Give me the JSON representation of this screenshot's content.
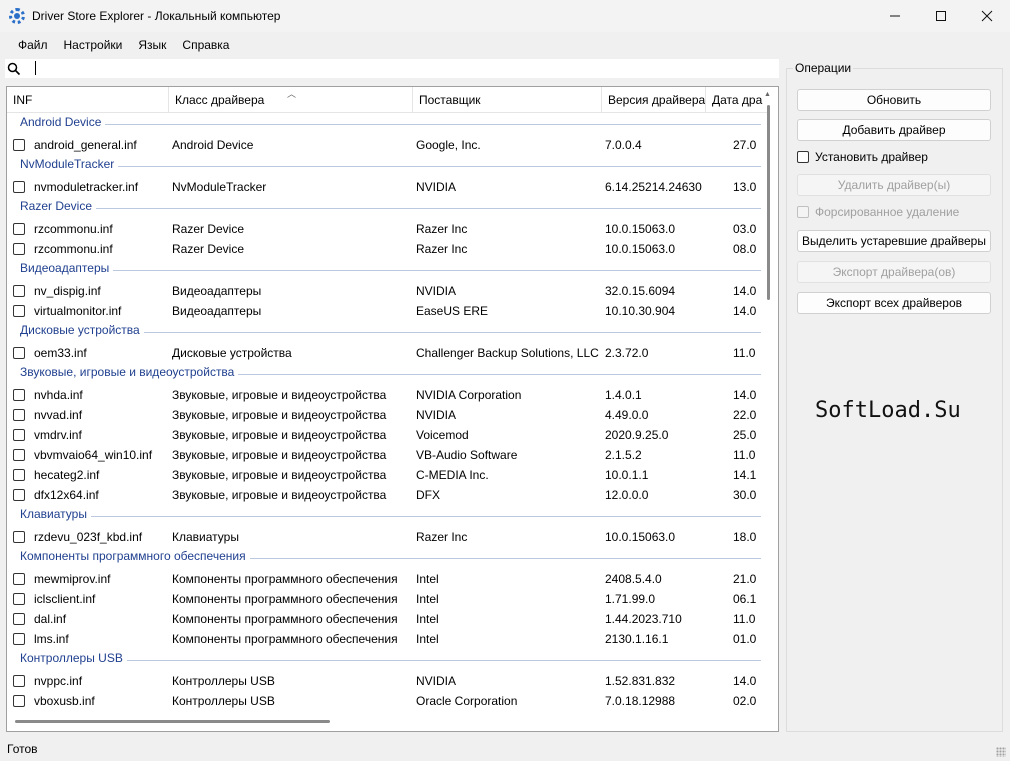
{
  "window": {
    "title": "Driver Store Explorer - Локальный компьютер",
    "icon": "gear-icon"
  },
  "menu": [
    "Файл",
    "Настройки",
    "Язык",
    "Справка"
  ],
  "search": {
    "value": "",
    "placeholder": ""
  },
  "columns": [
    "INF",
    "Класс драйвера",
    "Поставщик",
    "Версия драйвера",
    "Дата дра"
  ],
  "groups": [
    {
      "name": "Android Device",
      "rows": [
        {
          "inf": "android_general.inf",
          "cls": "Android Device",
          "prov": "Google, Inc.",
          "ver": "7.0.0.4",
          "date": "27.0"
        }
      ]
    },
    {
      "name": "NvModuleTracker",
      "rows": [
        {
          "inf": "nvmoduletracker.inf",
          "cls": "NvModuleTracker",
          "prov": "NVIDIA",
          "ver": "6.14.25214.24630",
          "date": "13.0"
        }
      ]
    },
    {
      "name": "Razer Device",
      "rows": [
        {
          "inf": "rzcommonu.inf",
          "cls": "Razer Device",
          "prov": "Razer Inc",
          "ver": "10.0.15063.0",
          "date": "03.0"
        },
        {
          "inf": "rzcommonu.inf",
          "cls": "Razer Device",
          "prov": "Razer Inc",
          "ver": "10.0.15063.0",
          "date": "08.0"
        }
      ]
    },
    {
      "name": "Видеоадаптеры",
      "rows": [
        {
          "inf": "nv_dispig.inf",
          "cls": "Видеоадаптеры",
          "prov": "NVIDIA",
          "ver": "32.0.15.6094",
          "date": "14.0"
        },
        {
          "inf": "virtualmonitor.inf",
          "cls": "Видеоадаптеры",
          "prov": "EaseUS ERE",
          "ver": "10.10.30.904",
          "date": "14.0"
        }
      ]
    },
    {
      "name": "Дисковые устройства",
      "rows": [
        {
          "inf": "oem33.inf",
          "cls": "Дисковые устройства",
          "prov": "Challenger Backup Solutions, LLC",
          "ver": "2.3.72.0",
          "date": "11.0"
        }
      ]
    },
    {
      "name": "Звуковые, игровые и видеоустройства",
      "rows": [
        {
          "inf": "nvhda.inf",
          "cls": "Звуковые, игровые и видеоустройства",
          "prov": "NVIDIA Corporation",
          "ver": "1.4.0.1",
          "date": "14.0"
        },
        {
          "inf": "nvvad.inf",
          "cls": "Звуковые, игровые и видеоустройства",
          "prov": "NVIDIA",
          "ver": "4.49.0.0",
          "date": "22.0"
        },
        {
          "inf": "vmdrv.inf",
          "cls": "Звуковые, игровые и видеоустройства",
          "prov": "Voicemod",
          "ver": "2020.9.25.0",
          "date": "25.0"
        },
        {
          "inf": "vbvmvaio64_win10.inf",
          "cls": "Звуковые, игровые и видеоустройства",
          "prov": "VB-Audio Software",
          "ver": "2.1.5.2",
          "date": "11.0"
        },
        {
          "inf": "hecateg2.inf",
          "cls": "Звуковые, игровые и видеоустройства",
          "prov": "C-MEDIA Inc.",
          "ver": "10.0.1.1",
          "date": "14.1"
        },
        {
          "inf": "dfx12x64.inf",
          "cls": "Звуковые, игровые и видеоустройства",
          "prov": "DFX",
          "ver": "12.0.0.0",
          "date": "30.0"
        }
      ]
    },
    {
      "name": "Клавиатуры",
      "rows": [
        {
          "inf": "rzdevu_023f_kbd.inf",
          "cls": "Клавиатуры",
          "prov": "Razer Inc",
          "ver": "10.0.15063.0",
          "date": "18.0"
        }
      ]
    },
    {
      "name": "Компоненты программного обеспечения",
      "rows": [
        {
          "inf": "mewmiprov.inf",
          "cls": "Компоненты программного обеспечения",
          "prov": "Intel",
          "ver": "2408.5.4.0",
          "date": "21.0"
        },
        {
          "inf": "iclsclient.inf",
          "cls": "Компоненты программного обеспечения",
          "prov": "Intel",
          "ver": "1.71.99.0",
          "date": "06.1"
        },
        {
          "inf": "dal.inf",
          "cls": "Компоненты программного обеспечения",
          "prov": "Intel",
          "ver": "1.44.2023.710",
          "date": "11.0"
        },
        {
          "inf": "lms.inf",
          "cls": "Компоненты программного обеспечения",
          "prov": "Intel",
          "ver": "2130.1.16.1",
          "date": "01.0"
        }
      ]
    },
    {
      "name": "Контроллеры USB",
      "rows": [
        {
          "inf": "nvppc.inf",
          "cls": "Контроллеры USB",
          "prov": "NVIDIA",
          "ver": "1.52.831.832",
          "date": "14.0"
        },
        {
          "inf": "vboxusb.inf",
          "cls": "Контроллеры USB",
          "prov": "Oracle Corporation",
          "ver": "7.0.18.12988",
          "date": "02.0"
        }
      ]
    }
  ],
  "operations": {
    "title": "Операции",
    "refresh": "Обновить",
    "add_driver": "Добавить драйвер",
    "install_driver": "Установить драйвер",
    "delete_driver": "Удалить драйвер(ы)",
    "force_delete": "Форсированное удаление",
    "select_old": "Выделить устаревшие драйверы",
    "export_driver": "Экспорт драйвера(ов)",
    "export_all": "Экспорт всех драйверов"
  },
  "watermark": "SoftLoad.Su",
  "status": "Готов"
}
